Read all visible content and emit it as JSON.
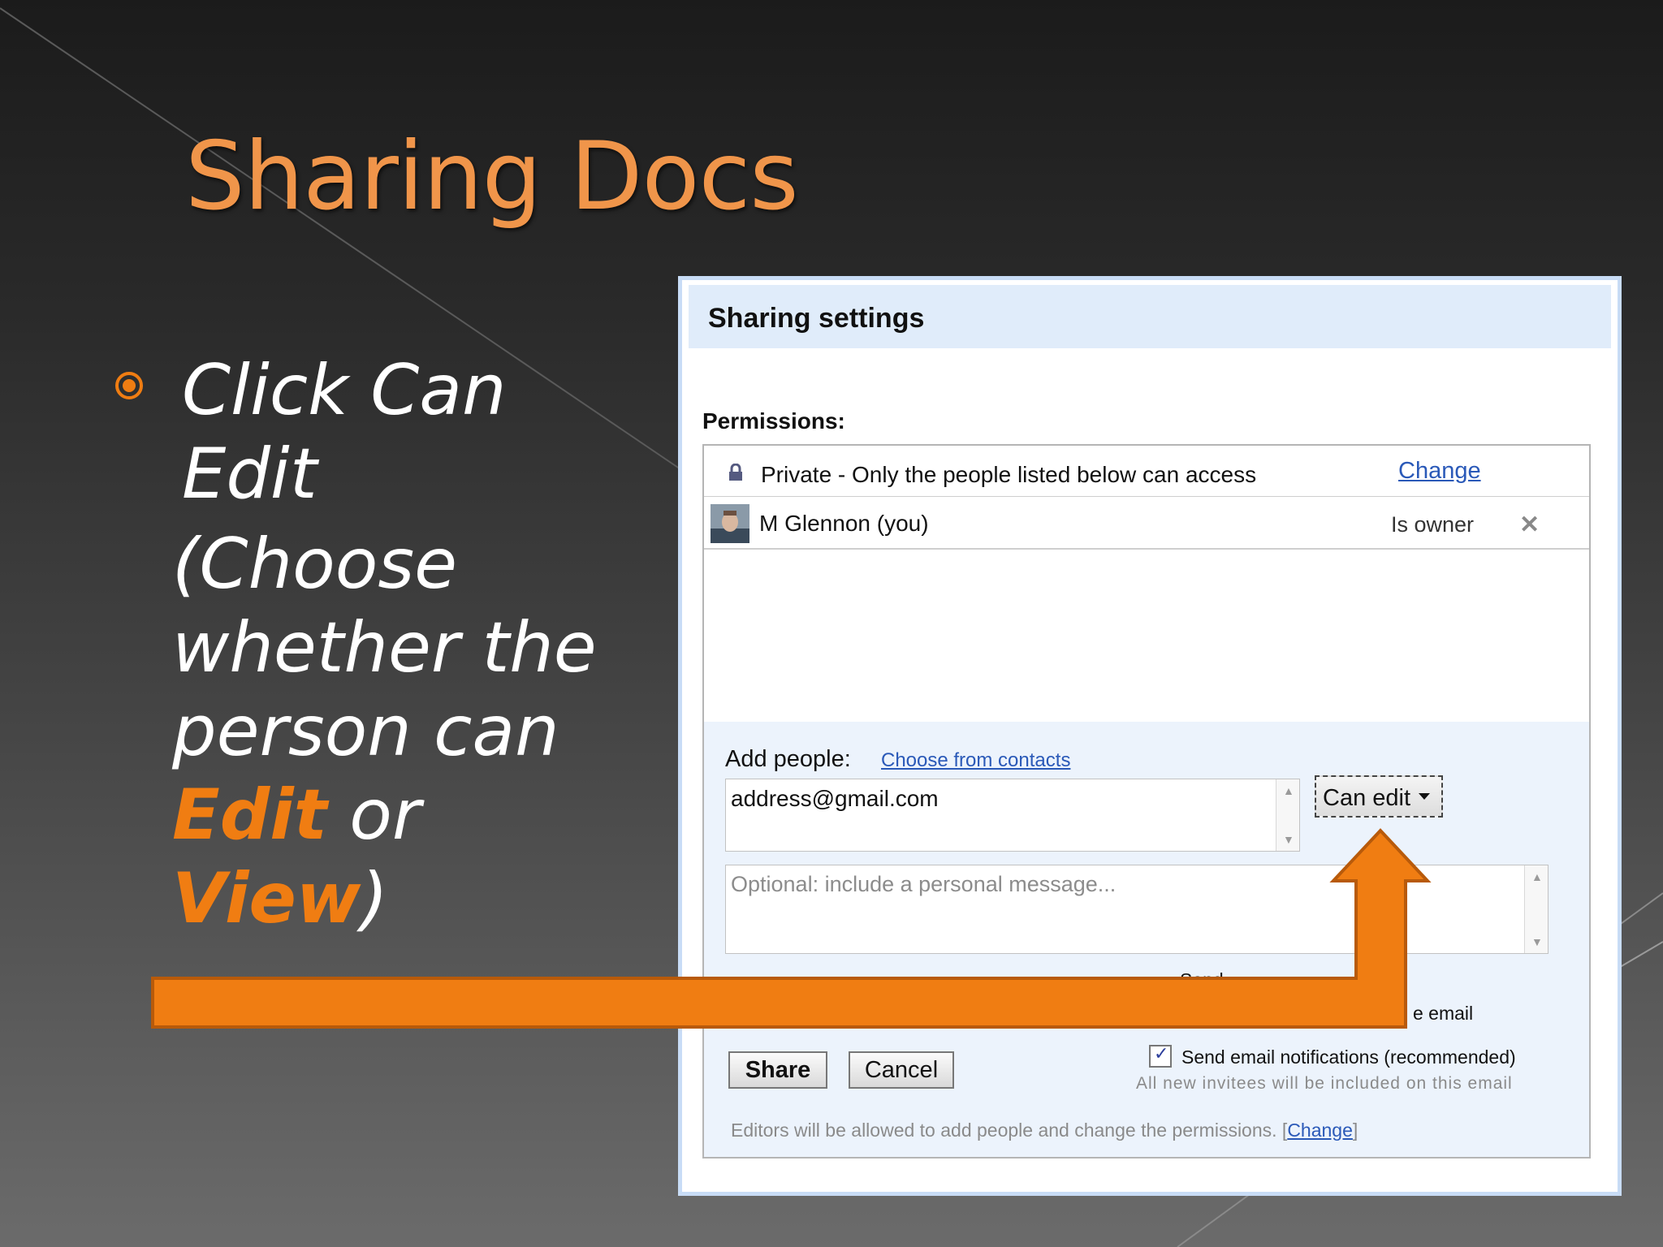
{
  "slide": {
    "title": "Sharing Docs",
    "bullet": {
      "line1": "Click Can Edit",
      "line2_prefix": "(Choose whether the person can ",
      "edit": "Edit",
      "or": " or ",
      "view": "View",
      "line2_suffix": ")"
    },
    "accent_color": "#f07d12",
    "title_color": "#f0954a"
  },
  "dialog": {
    "title": "Sharing settings",
    "permissions_label": "Permissions:",
    "visibility": {
      "icon": "lock-icon",
      "text": "Private - Only the people listed below can access",
      "change_link": "Change"
    },
    "owner": {
      "name": "M Glennon (you)",
      "role": "Is owner",
      "remove_icon": "✕"
    },
    "add_people": {
      "label": "Add people:",
      "contacts_link": "Choose from contacts",
      "email_value": "address@gmail.com",
      "permission_select": "Can edit",
      "message_placeholder": "Optional: include a personal message..."
    },
    "partially_hidden": {
      "notify_text_fragment": "Send ... ",
      "email_fragment": "e email"
    },
    "share_button": "Share",
    "cancel_button": "Cancel",
    "send_notifications": {
      "checked": true,
      "label": "Send email notifications (recommended)",
      "note": "All new invitees will be included on this email"
    },
    "editors_note": "Editors will be allowed to add people and change the permissions.",
    "editors_change_link": "Change",
    "header_color": "#e0ecfa",
    "link_color": "#2a59b8"
  }
}
